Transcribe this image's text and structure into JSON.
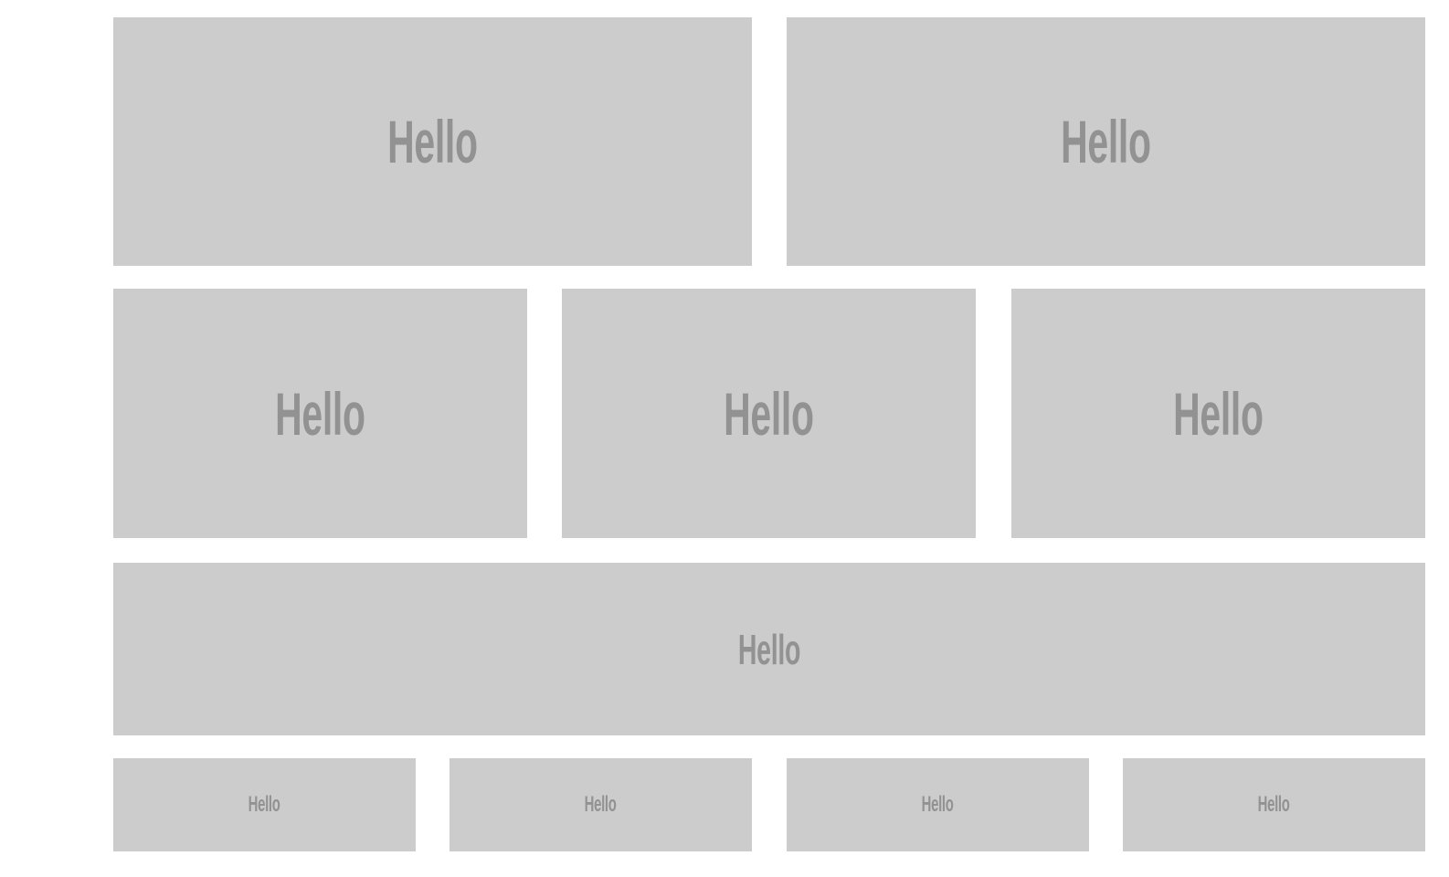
{
  "colors": {
    "background": "#ffffff",
    "tile_fill": "#cccccc",
    "tile_text": "#929292"
  },
  "rows": [
    {
      "tiles": [
        {
          "label": "Hello"
        },
        {
          "label": "Hello"
        }
      ]
    },
    {
      "tiles": [
        {
          "label": "Hello"
        },
        {
          "label": "Hello"
        },
        {
          "label": "Hello"
        }
      ]
    },
    {
      "tiles": [
        {
          "label": "Hello"
        }
      ]
    },
    {
      "tiles": [
        {
          "label": "Hello"
        },
        {
          "label": "Hello"
        },
        {
          "label": "Hello"
        },
        {
          "label": "Hello"
        }
      ]
    }
  ]
}
